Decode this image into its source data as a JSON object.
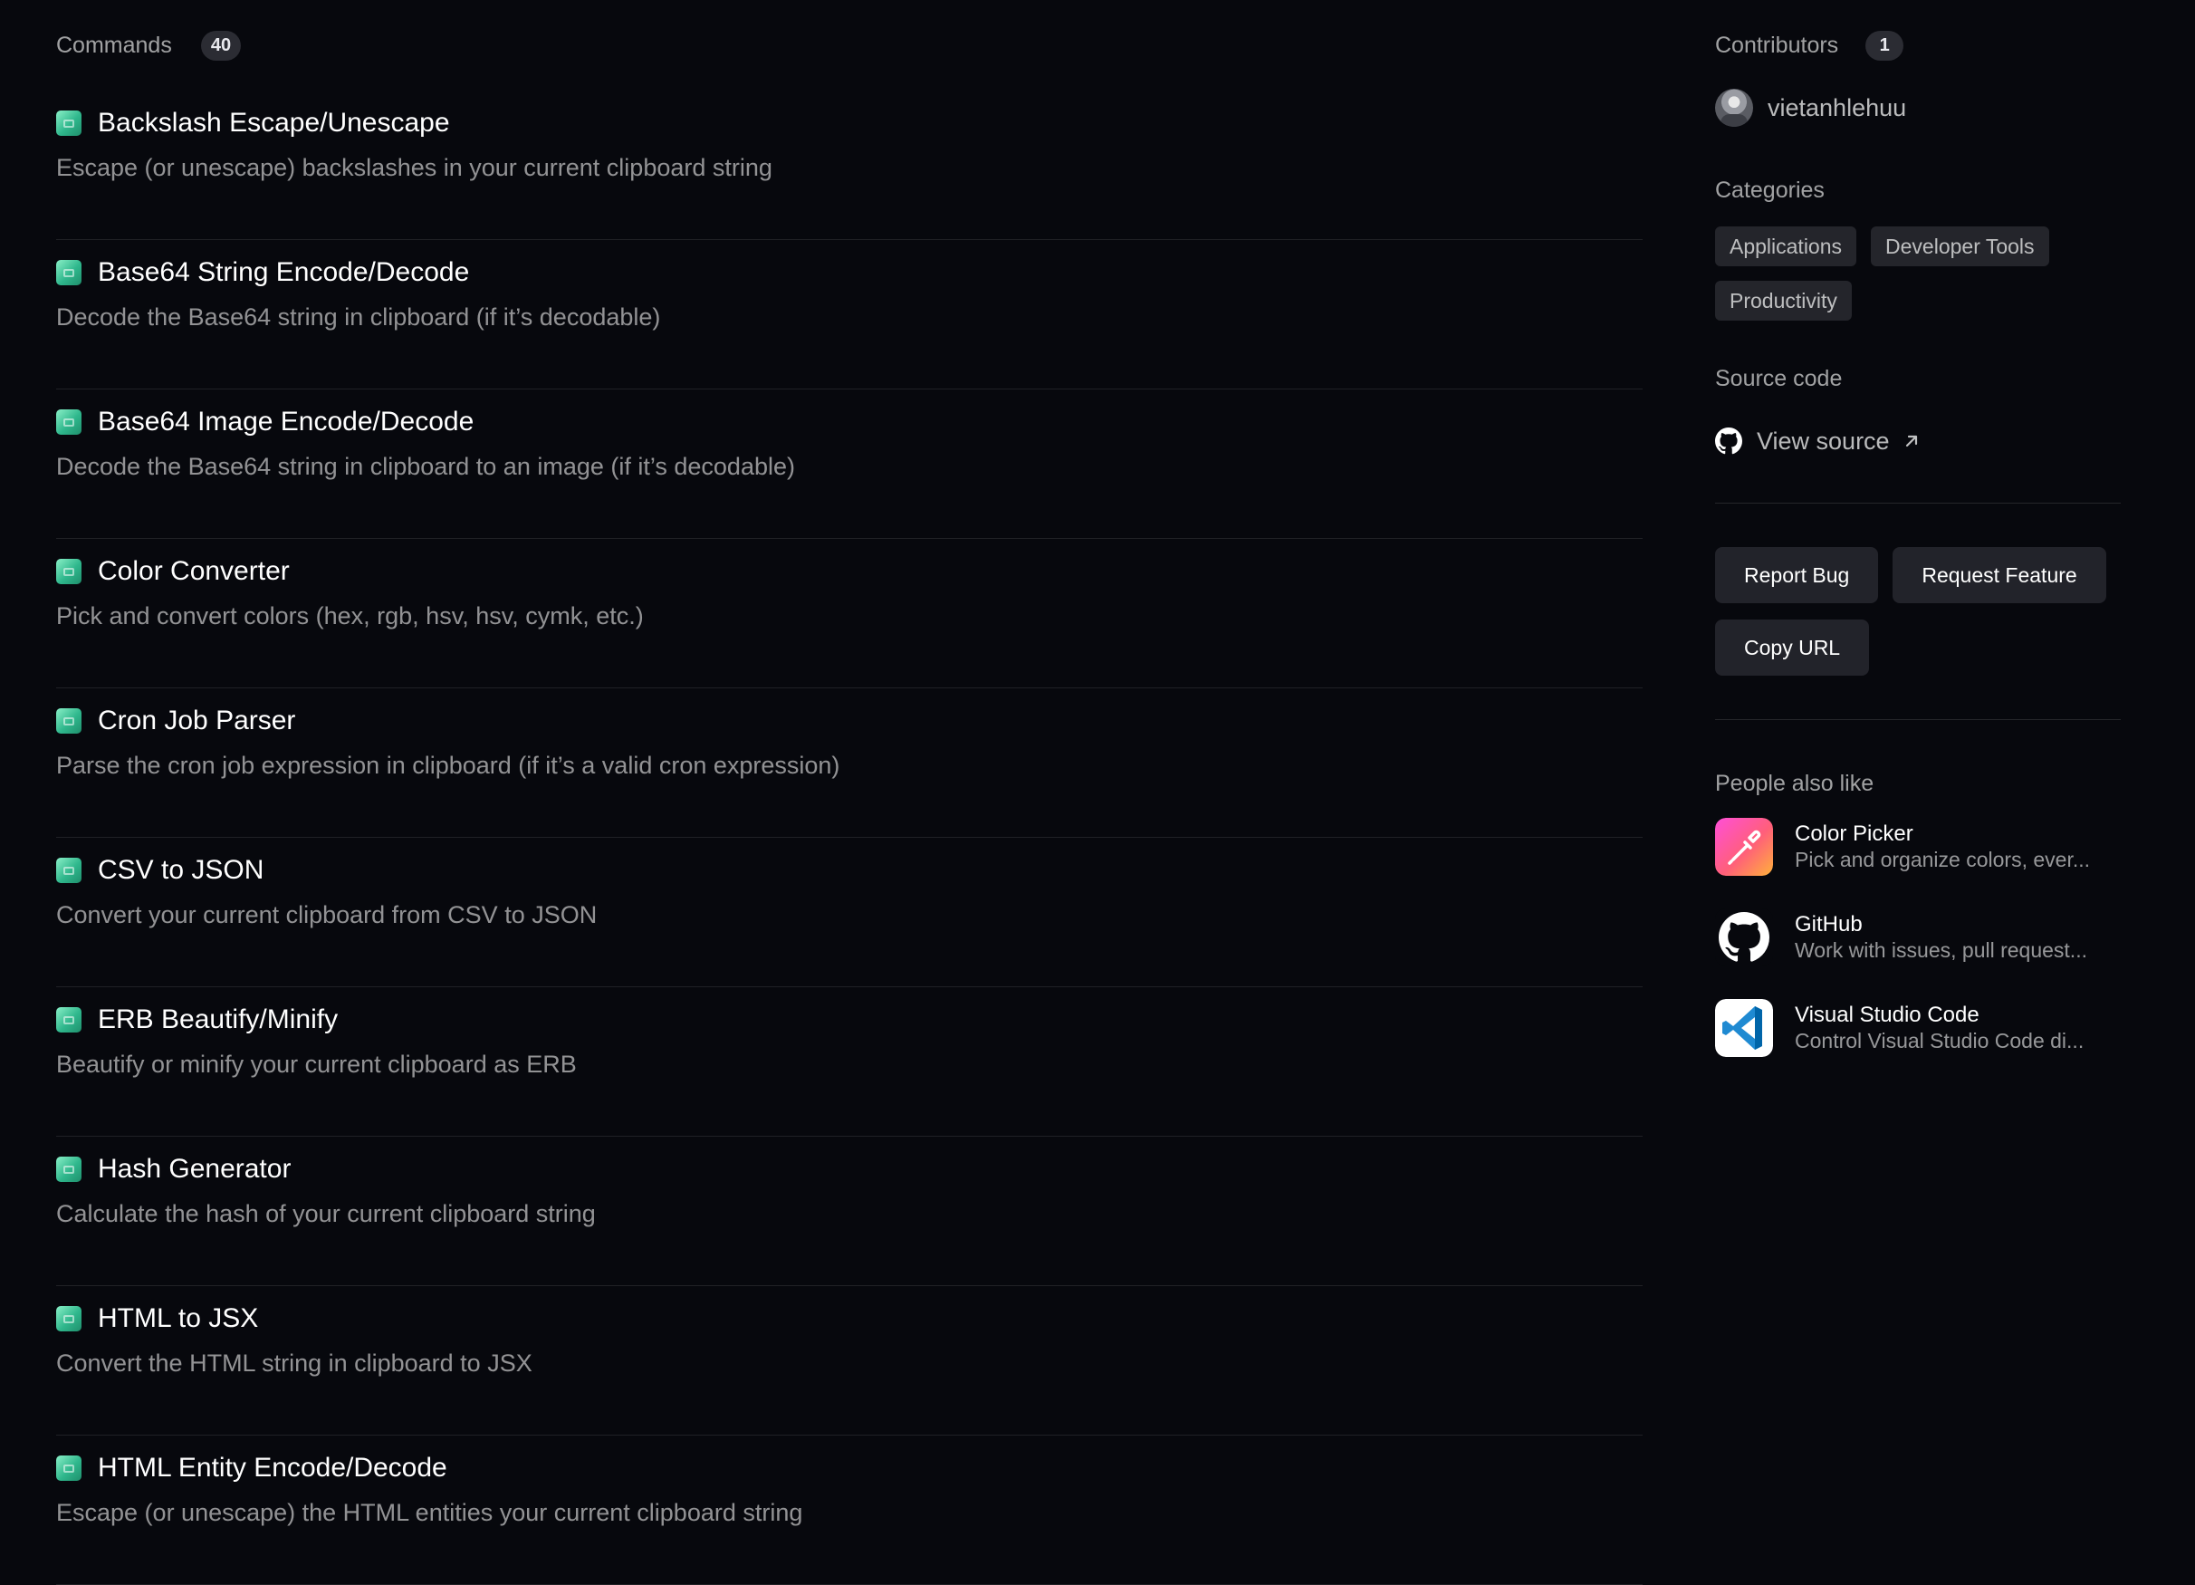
{
  "commands": {
    "label": "Commands",
    "count": "40",
    "items": [
      {
        "title": "Backslash Escape/Unescape",
        "description": "Escape (or unescape) backslashes in your current clipboard string"
      },
      {
        "title": "Base64 String Encode/Decode",
        "description": "Decode the Base64 string in clipboard (if it’s decodable)"
      },
      {
        "title": "Base64 Image Encode/Decode",
        "description": "Decode the Base64 string in clipboard to an image (if it’s decodable)"
      },
      {
        "title": "Color Converter",
        "description": "Pick and convert colors (hex, rgb, hsv, hsv, cymk, etc.)"
      },
      {
        "title": "Cron Job Parser",
        "description": "Parse the cron job expression in clipboard (if it’s a valid cron expression)"
      },
      {
        "title": "CSV to JSON",
        "description": "Convert your current clipboard from CSV to JSON"
      },
      {
        "title": "ERB Beautify/Minify",
        "description": "Beautify or minify your current clipboard as ERB"
      },
      {
        "title": "Hash Generator",
        "description": "Calculate the hash of your current clipboard string"
      },
      {
        "title": "HTML to JSX",
        "description": "Convert the HTML string in clipboard to JSX"
      },
      {
        "title": "HTML Entity Encode/Decode",
        "description": "Escape (or unescape) the HTML entities your current clipboard string"
      }
    ],
    "icon": "extension-icon"
  },
  "sidebar": {
    "contributors": {
      "label": "Contributors",
      "count": "1",
      "items": [
        {
          "name": "vietanhlehuu"
        }
      ]
    },
    "categories": {
      "label": "Categories",
      "tags": [
        "Applications",
        "Developer Tools",
        "Productivity"
      ]
    },
    "source": {
      "label": "Source code",
      "link_label": "View source",
      "icon": "github-icon"
    },
    "actions": {
      "report_bug": "Report Bug",
      "request_feature": "Request Feature",
      "copy_url": "Copy URL"
    },
    "also_like": {
      "label": "People also like",
      "items": [
        {
          "title": "Color Picker",
          "description": "Pick and organize colors, ever...",
          "icon": "color-picker-icon"
        },
        {
          "title": "GitHub",
          "description": "Work with issues, pull request...",
          "icon": "github-icon"
        },
        {
          "title": "Visual Studio Code",
          "description": "Control Visual Studio Code di...",
          "icon": "vscode-icon"
        }
      ]
    }
  },
  "colors": {
    "background": "#07080d",
    "badge": "#2b2c33",
    "tag": "#24252b",
    "button": "#22232a",
    "extension_icon": "#2fb78c"
  }
}
